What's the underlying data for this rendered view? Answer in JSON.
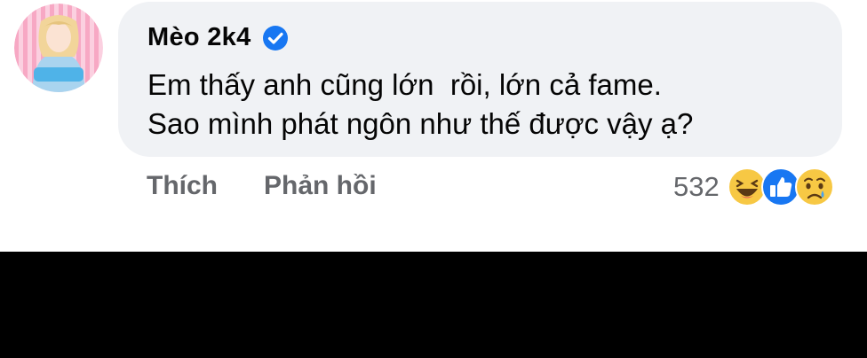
{
  "comment": {
    "author": "Mèo 2k4",
    "verified": true,
    "text": "Em thấy anh cũng lớn  rồi, lớn cả fame.\nSao mình phát ngôn như thế được vậy ạ?",
    "avatar_label": "Mèo 2k4"
  },
  "actions": {
    "like_label": "Thích",
    "reply_label": "Phản hồi"
  },
  "reactions": {
    "count": "532",
    "icons": [
      "haha-icon",
      "like-icon",
      "sad-icon"
    ]
  },
  "colors": {
    "bubble": "#f0f2f5",
    "verified_blue": "#1877f2",
    "secondary_text": "#65676b",
    "primary_text": "#050505"
  }
}
